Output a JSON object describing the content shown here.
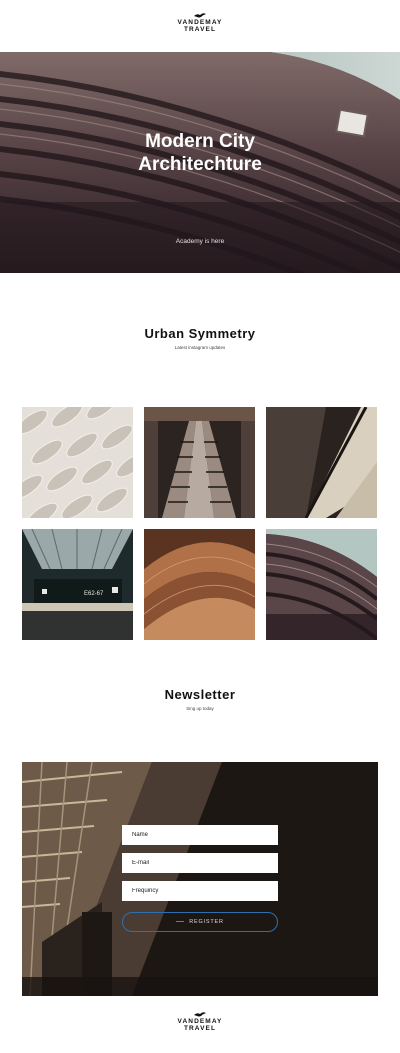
{
  "brand": {
    "line1": "VANDEMAY",
    "line2": "TRAVEL"
  },
  "hero": {
    "title_line1": "Modern City",
    "title_line2": "Architechture",
    "subtitle": "Academy is here"
  },
  "gallery": {
    "title": "Urban Symmetry",
    "subtitle": "Latest instagram updates",
    "sign_text": "E62-67"
  },
  "newsletter": {
    "title": "Newsletter",
    "subtitle": "Sing up today",
    "fields": {
      "name_placeholder": "Name",
      "email_placeholder": "E-mail",
      "frequency_placeholder": "Frequincy"
    },
    "button_label": "REGISTER"
  },
  "colors": {
    "hero_bg": "#2f2228",
    "newsletter_bg": "#2b221d",
    "button_border": "#2f6fb0",
    "sky": "#bfcfcc"
  }
}
